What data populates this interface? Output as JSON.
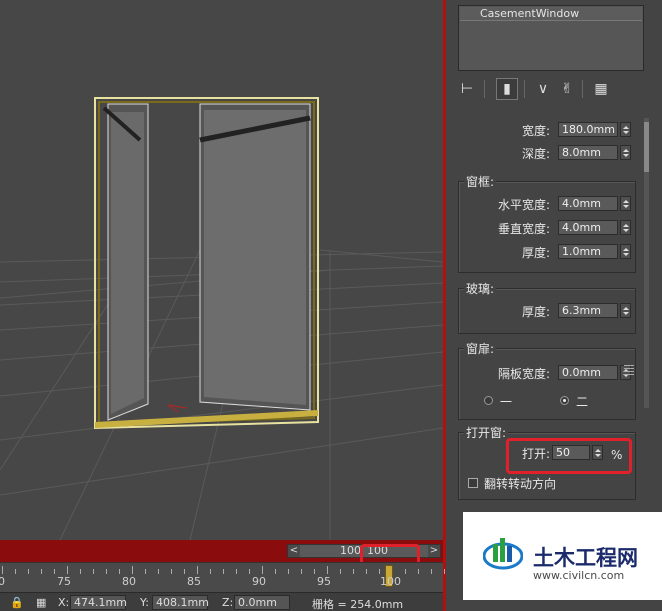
{
  "object_name": "CasementWindow",
  "panel_tab_icons": [
    "pin-icon",
    "modifier-stack-icon",
    "make-unique-icon",
    "remove-modifier-icon",
    "configure-icon"
  ],
  "params": {
    "width_label": "宽度:",
    "width_value": "180.0mm",
    "depth_label": "深度:",
    "depth_value": "8.0mm"
  },
  "frame": {
    "title": "窗框:",
    "h_width_label": "水平宽度:",
    "h_width_value": "4.0mm",
    "v_width_label": "垂直宽度:",
    "v_width_value": "4.0mm",
    "thickness_label": "厚度:",
    "thickness_value": "1.0mm"
  },
  "glazing": {
    "title": "玻璃:",
    "thickness_label": "厚度:",
    "thickness_value": "6.3mm"
  },
  "casements": {
    "title": "窗扉:",
    "panel_width_label": "隔板宽度:",
    "panel_width_value": "0.0mm",
    "radio_one_label": "一",
    "radio_two_label": "二",
    "selected": "二"
  },
  "open_window": {
    "title": "打开窗:",
    "open_label": "打开:",
    "open_value": "50",
    "open_unit": "%",
    "flip_label": "翻转转动方向"
  },
  "timeline": {
    "prev": "<",
    "next": ">",
    "slider_text_left": "100",
    "slider_text_right": "100",
    "tick_labels": [
      "0",
      "75",
      "80",
      "85",
      "90",
      "95",
      "100"
    ],
    "current_frame": 100
  },
  "status": {
    "x_label": "X:",
    "x_value": "474.1mm",
    "y_label": "Y:",
    "y_value": "408.1mm",
    "z_label": "Z:",
    "z_value": "0.0mm",
    "grid_text": "栅格 = 254.0mm"
  },
  "watermark": {
    "title": "土木工程网",
    "url": "www.civilcn.com"
  }
}
